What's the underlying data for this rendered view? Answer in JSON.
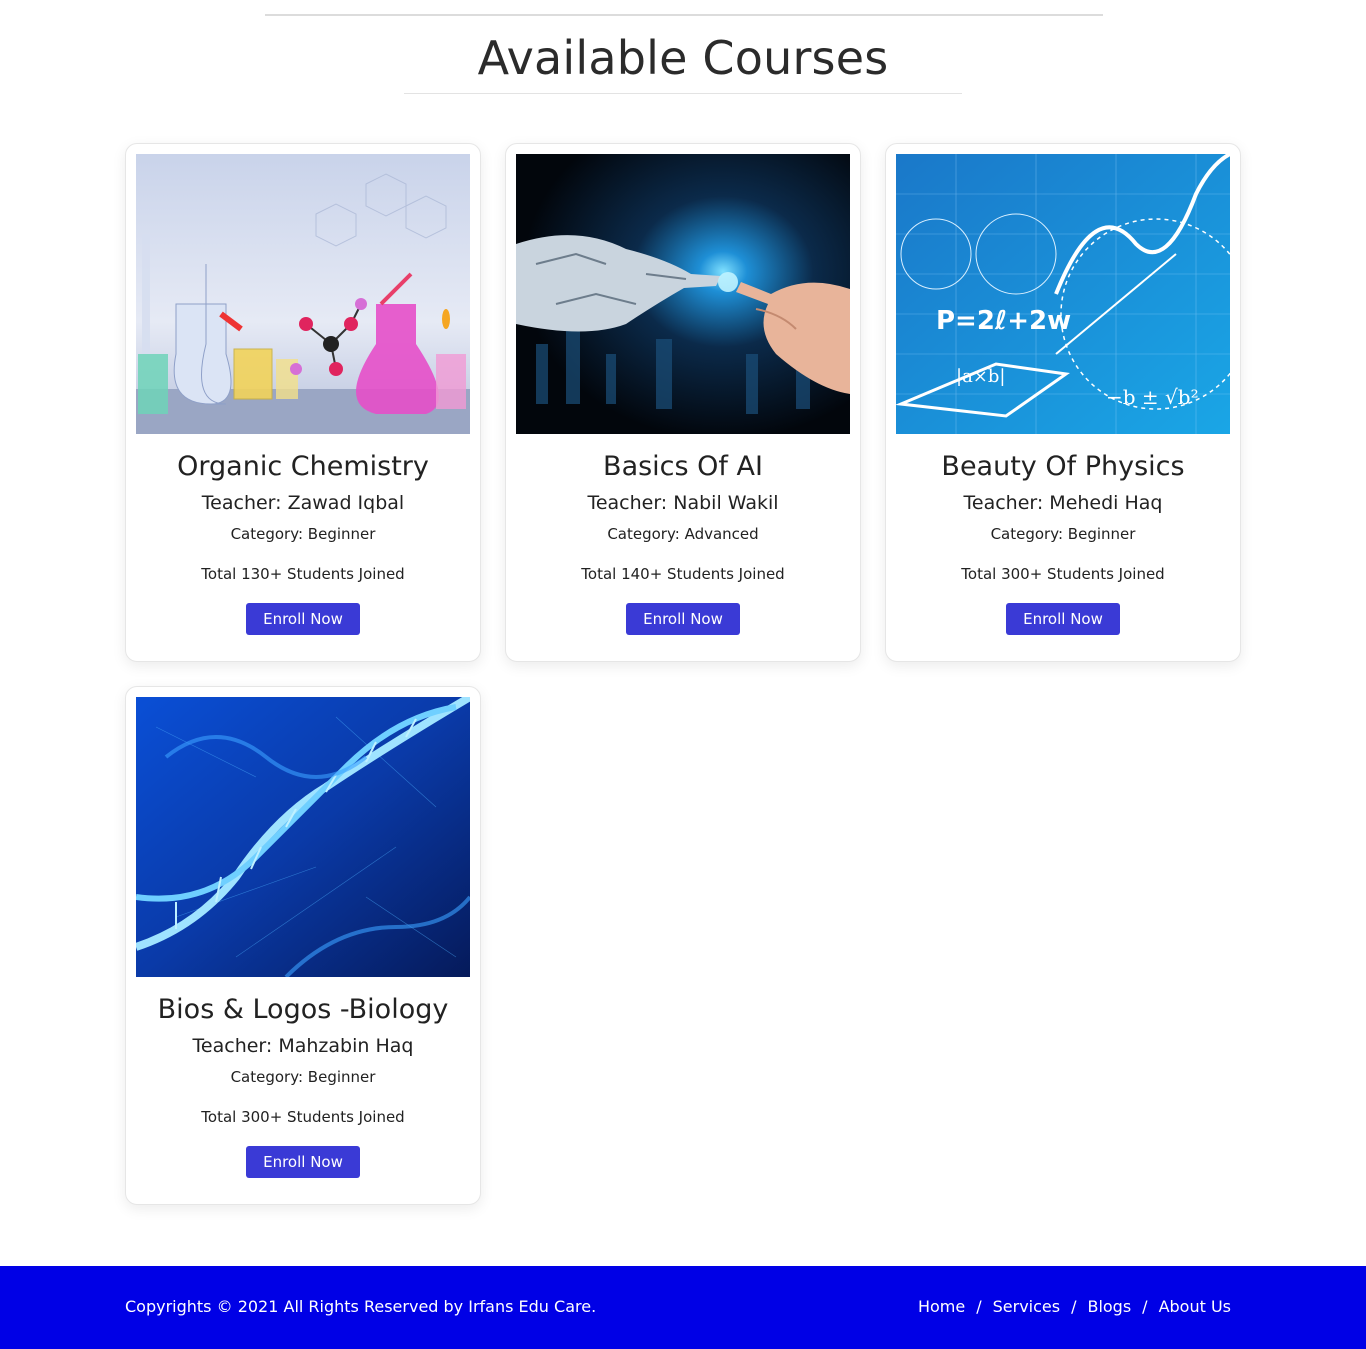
{
  "page": {
    "title": "Available Courses"
  },
  "courses": [
    {
      "title": "Organic Chemistry",
      "teacher": "Teacher: Zawad Iqbal",
      "category": "Category: Beginner",
      "students": "Total 130+ Students Joined",
      "button": "Enroll Now",
      "image": "chemistry-lab-image"
    },
    {
      "title": "Basics Of AI",
      "teacher": "Teacher: Nabil Wakil",
      "category": "Category: Advanced",
      "students": "Total 140+ Students Joined",
      "button": "Enroll Now",
      "image": "robot-human-hands-image"
    },
    {
      "title": "Beauty Of Physics",
      "teacher": "Teacher: Mehedi Haq",
      "category": "Category: Beginner",
      "students": "Total 300+ Students Joined",
      "button": "Enroll Now",
      "image": "physics-formulas-image"
    },
    {
      "title": "Bios & Logos -Biology",
      "teacher": "Teacher: Mahzabin Haq",
      "category": "Category: Beginner",
      "students": "Total 300+ Students Joined",
      "button": "Enroll Now",
      "image": "dna-helix-image"
    }
  ],
  "footer": {
    "copyright": "Copyrights © 2021 All Rights Reserved by Irfans Edu Care.",
    "links": [
      "Home",
      "Services",
      "Blogs",
      "About Us"
    ],
    "separator": "/"
  },
  "colors": {
    "button": "#3a3ad6",
    "footer_bg": "#0000e6"
  }
}
